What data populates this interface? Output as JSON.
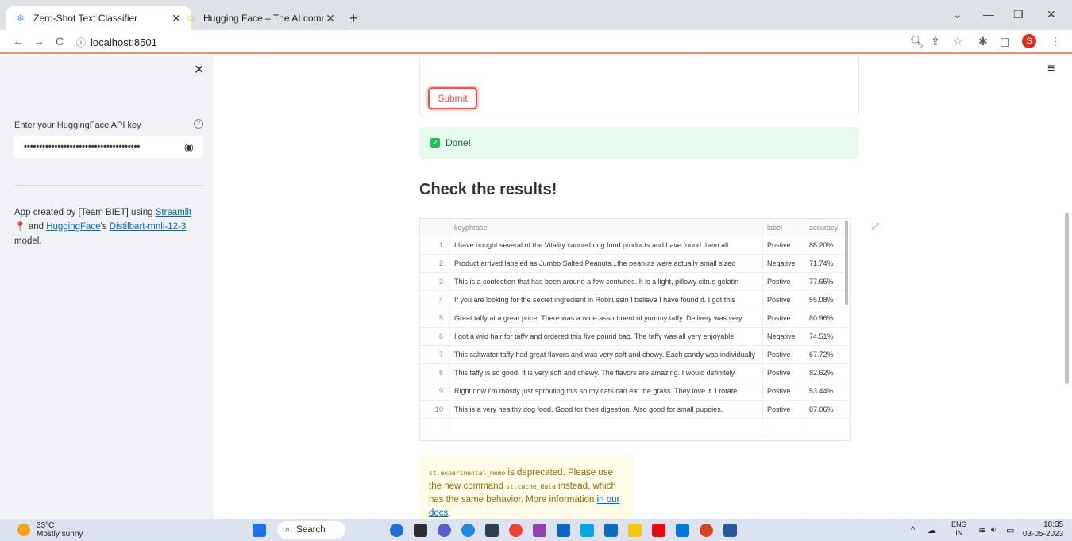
{
  "browser": {
    "tabs": [
      {
        "title": "Zero-Shot Text Classifier",
        "icon": "snowflake-icon",
        "active": true
      },
      {
        "title": "Hugging Face – The AI communi",
        "icon": "hugging-face-icon",
        "active": false
      }
    ],
    "url": "localhost:8501",
    "profile_initial": "S"
  },
  "sidebar": {
    "close_glyph": "✕",
    "api_label": "Enter your HuggingFace API key",
    "api_value": "••••••••••••••••••••••••••••••••••••••",
    "credit": {
      "prefix": "App created by [Team BIET] using ",
      "streamlit": "Streamlit",
      "and": " and ",
      "huggingface": "HuggingFace",
      "mid": "'s ",
      "model_link": "Distilbart-mnli-12-3",
      "suffix": " model."
    }
  },
  "main": {
    "submit_label": "Submit",
    "done_text": "Done!",
    "results_title": "Check the results!",
    "table": {
      "headers": {
        "keyphrase": "keyphrase",
        "label": "label",
        "accuracy": "accuracy"
      },
      "rows": [
        {
          "idx": "1",
          "keyphrase": "I have bought several of the Vitality canned dog food products and have found them all",
          "label": "Postive",
          "accuracy": "88.20%"
        },
        {
          "idx": "2",
          "keyphrase": "Product arrived labeled as Jumbo Salted Peanuts...the peanuts were actually small sized",
          "label": "Negative",
          "accuracy": "71.74%"
        },
        {
          "idx": "3",
          "keyphrase": "This is a confection that has been around a few centuries.  It is a light, pillowy citrus gelatin",
          "label": "Postive",
          "accuracy": "77.65%"
        },
        {
          "idx": "4",
          "keyphrase": "If you are looking for the secret ingredient in Robitussin I believe I have found it.  I got this",
          "label": "Postive",
          "accuracy": "55.08%"
        },
        {
          "idx": "5",
          "keyphrase": "Great taffy at a great price.  There was a wide assortment of yummy taffy.  Delivery was very",
          "label": "Postive",
          "accuracy": "80.96%"
        },
        {
          "idx": "6",
          "keyphrase": "I got a wild hair for taffy and ordered this five pound bag. The taffy was all very enjoyable",
          "label": "Negative",
          "accuracy": "74.51%"
        },
        {
          "idx": "7",
          "keyphrase": "This saltwater taffy had great flavors and was very soft and chewy.  Each candy was individually",
          "label": "Postive",
          "accuracy": "67.72%"
        },
        {
          "idx": "8",
          "keyphrase": "This taffy is so good.  It is very soft and chewy.  The flavors are amazing.  I would definitely",
          "label": "Postive",
          "accuracy": "82.62%"
        },
        {
          "idx": "9",
          "keyphrase": "Right now I'm mostly just sprouting this so my cats can eat the grass. They love it. I rotate",
          "label": "Postive",
          "accuracy": "53.44%"
        },
        {
          "idx": "10",
          "keyphrase": "This is a very healthy dog food. Good for their digestion. Also good for small puppies.",
          "label": "Postive",
          "accuracy": "87.06%"
        }
      ]
    },
    "warning": {
      "code1": "st.experimental_memo",
      "t1": " is deprecated. Please use the new command ",
      "code2": "st.cache_data",
      "t2": " instead, which has the same behavior. More information ",
      "link": "in our docs",
      "t3": "."
    }
  },
  "taskbar": {
    "temp": "33°C",
    "weather": "Mostly sunny",
    "search": "Search",
    "lang_top": "ENG",
    "lang_bottom": "IN",
    "time": "18:35",
    "date": "03-05-2023"
  },
  "colors": {
    "accent": "#ff4b4b",
    "success_bg": "#e8f9ee",
    "warning_bg": "#fffce7",
    "link": "#0068c9"
  }
}
